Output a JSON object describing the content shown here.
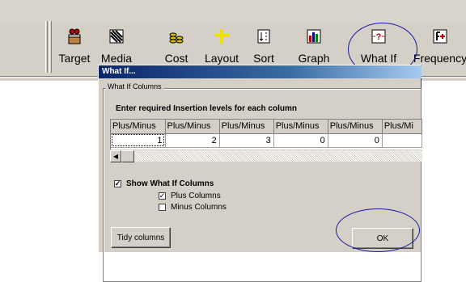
{
  "toolbar": {
    "buttons": [
      {
        "label": "Target",
        "icon": "target-icon"
      },
      {
        "label": "Media",
        "icon": "media-icon"
      },
      {
        "label": "Cost",
        "icon": "cost-icon"
      },
      {
        "label": "Layout",
        "icon": "layout-icon"
      },
      {
        "label": "Sort",
        "icon": "sort-icon"
      },
      {
        "label": "Graph",
        "icon": "graph-icon"
      },
      {
        "label": "What If",
        "icon": "what-if-icon"
      },
      {
        "label": "Frequency",
        "icon": "frequency-icon"
      }
    ]
  },
  "dialog": {
    "title": "What If...",
    "group_label": "What If Columns",
    "instruction": "Enter required Insertion levels for each column",
    "columns": [
      "Plus/Minus",
      "Plus/Minus",
      "Plus/Minus",
      "Plus/Minus",
      "Plus/Minus",
      "Plus/Mi"
    ],
    "values": [
      "1",
      "2",
      "3",
      "0",
      "0",
      ""
    ],
    "show_what_if": {
      "label": "Show What If Columns",
      "checked": true
    },
    "plus_columns": {
      "label": "Plus Columns",
      "checked": true
    },
    "minus_columns": {
      "label": "Minus Columns",
      "checked": false
    },
    "tidy_button": "Tidy columns",
    "ok_button": "OK"
  },
  "colors": {
    "annotation_circle": "#1a1aa0",
    "titlebar_start": "#0a246a",
    "face": "#d4d0c8"
  }
}
